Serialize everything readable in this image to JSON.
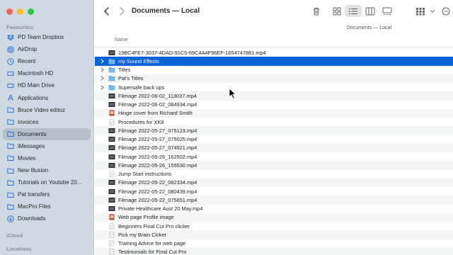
{
  "window": {
    "title": "Documents — Local",
    "path": "Documents — Local"
  },
  "colors": {
    "accent": "#0a64d8",
    "sidebar_bg": "#cfd9e2",
    "folder": "#5aa7e6"
  },
  "sidebar": {
    "sections": {
      "favourites": "Favourites",
      "icloud": "iCloud",
      "locations": "Locations"
    },
    "items": [
      {
        "label": "PD Team Dropbox",
        "icon": "dropbox-icon"
      },
      {
        "label": "AirDrop",
        "icon": "airdrop-icon"
      },
      {
        "label": "Recent",
        "icon": "clock-icon"
      },
      {
        "label": "Macintosh HD",
        "icon": "drive-icon"
      },
      {
        "label": "HD Main Drive",
        "icon": "drive-icon"
      },
      {
        "label": "Applications",
        "icon": "applications-icon"
      },
      {
        "label": "Bruce Video editoz",
        "icon": "folder-icon"
      },
      {
        "label": "Invoices",
        "icon": "folder-icon"
      },
      {
        "label": "Documents",
        "icon": "folder-icon"
      },
      {
        "label": "iMessages",
        "icon": "folder-icon"
      },
      {
        "label": "Movies",
        "icon": "folder-icon"
      },
      {
        "label": "New Illusion",
        "icon": "folder-icon"
      },
      {
        "label": "Tutorials on Youtube 20...",
        "icon": "folder-icon"
      },
      {
        "label": "Pat transfers",
        "icon": "folder-icon"
      },
      {
        "label": "MacPro Files",
        "icon": "folder-icon"
      },
      {
        "label": "Downloads",
        "icon": "download-icon"
      }
    ],
    "active_index": 8
  },
  "toolbar": {
    "back": "back-chevron-icon",
    "forward": "forward-chevron-icon",
    "view_mode": "list"
  },
  "columns": {
    "name": "Name"
  },
  "files": [
    {
      "name": "19BC4FE7-3037-4DAD-91C5-69C4A4F96EF-1654747881.mp4",
      "kind": "video"
    },
    {
      "name": "my Sound Effects",
      "kind": "folder",
      "selected": true
    },
    {
      "name": "Titles",
      "kind": "folder"
    },
    {
      "name": "Pat's Titles",
      "kind": "folder"
    },
    {
      "name": "Supersafe back ups",
      "kind": "folder"
    },
    {
      "name": "Filmage 2022-06-02_113037.mp4",
      "kind": "video"
    },
    {
      "name": "Filmage 2022-06-02_084934.mp4",
      "kind": "video"
    },
    {
      "name": "Hinge cover from Richard Smith",
      "kind": "image"
    },
    {
      "name": "Procedures for XK8",
      "kind": "document"
    },
    {
      "name": "Filmage 2022-05-27_075123.mp4",
      "kind": "video"
    },
    {
      "name": "Filmage 2022-05-27_075025.mp4",
      "kind": "video"
    },
    {
      "name": "Filmage 2022-05-27_074921.mp4",
      "kind": "video"
    },
    {
      "name": "Filmage 2022-05-26_162502.mp4",
      "kind": "video"
    },
    {
      "name": "Filmage 2022-05-26_155530.mp4",
      "kind": "video"
    },
    {
      "name": "Jump Start instructions",
      "kind": "document"
    },
    {
      "name": "Filmage 2022-05-22_082334.mp4",
      "kind": "video"
    },
    {
      "name": "Filmage 2022-05-22_080439.mp4",
      "kind": "video"
    },
    {
      "name": "Filmage 2022-05-22_075651.mp4",
      "kind": "video"
    },
    {
      "name": "Private Healthcare Aust 20 May.mp4",
      "kind": "video"
    },
    {
      "name": "Web page Profile image",
      "kind": "image"
    },
    {
      "name": "Beginners Final Cut Pro clicker",
      "kind": "document"
    },
    {
      "name": "Pick my Brain Clcker",
      "kind": "document"
    },
    {
      "name": "Training Advice for web page",
      "kind": "document"
    },
    {
      "name": "Testimonials for Final Cut Pro",
      "kind": "document"
    }
  ]
}
